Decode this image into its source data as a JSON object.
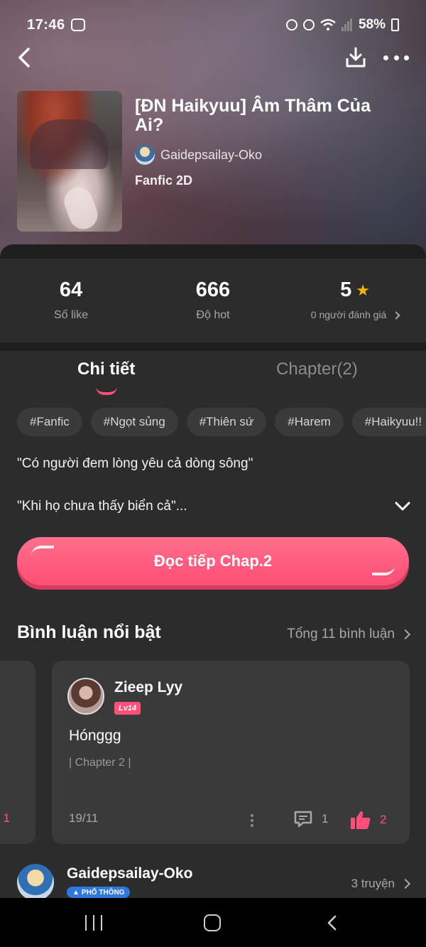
{
  "status_bar": {
    "time": "17:46",
    "battery": "58%"
  },
  "story": {
    "title": "[ĐN Haikyuu] Âm Thâm Của Ai?",
    "author": "Gaidepsailay-Oko",
    "genre": "Fanfic 2D"
  },
  "stats": [
    {
      "value": "64",
      "label": "Số like"
    },
    {
      "value": "666",
      "label": "Độ hot"
    },
    {
      "value": "5",
      "label": "0 người đánh giá"
    }
  ],
  "tabs": {
    "details": "Chi tiết",
    "chapters": "Chapter(2)"
  },
  "tags": [
    "#Fanfic",
    "#Ngọt sủng",
    "#Thiên sứ",
    "#Harem",
    "#Haikyuu!!"
  ],
  "description": {
    "line1": "\"Có người đem lòng yêu cả dòng sông\"",
    "line2": "\"Khi họ chưa thấy biển cả\"..."
  },
  "read_button": "Đọc tiếp Chap.2",
  "comments_section": {
    "title": "Bình luận nổi bật",
    "total": "Tổng 11 bình luận",
    "prev_card_count": "1",
    "featured": {
      "user": "Zieep Lyy",
      "level": "Lv14",
      "text": "Hónggg",
      "chapter": "| Chapter 2 |",
      "date": "19/11",
      "replies": "1",
      "likes": "2"
    }
  },
  "author_row": {
    "name": "Gaidepsailay-Oko",
    "badge": "PHỔ THÔNG",
    "stories": "3 truyện"
  },
  "colors": {
    "accent": "#ff4f7a",
    "star": "#f5b800",
    "background": "#1f1f1f",
    "card": "#3a3a3a"
  }
}
